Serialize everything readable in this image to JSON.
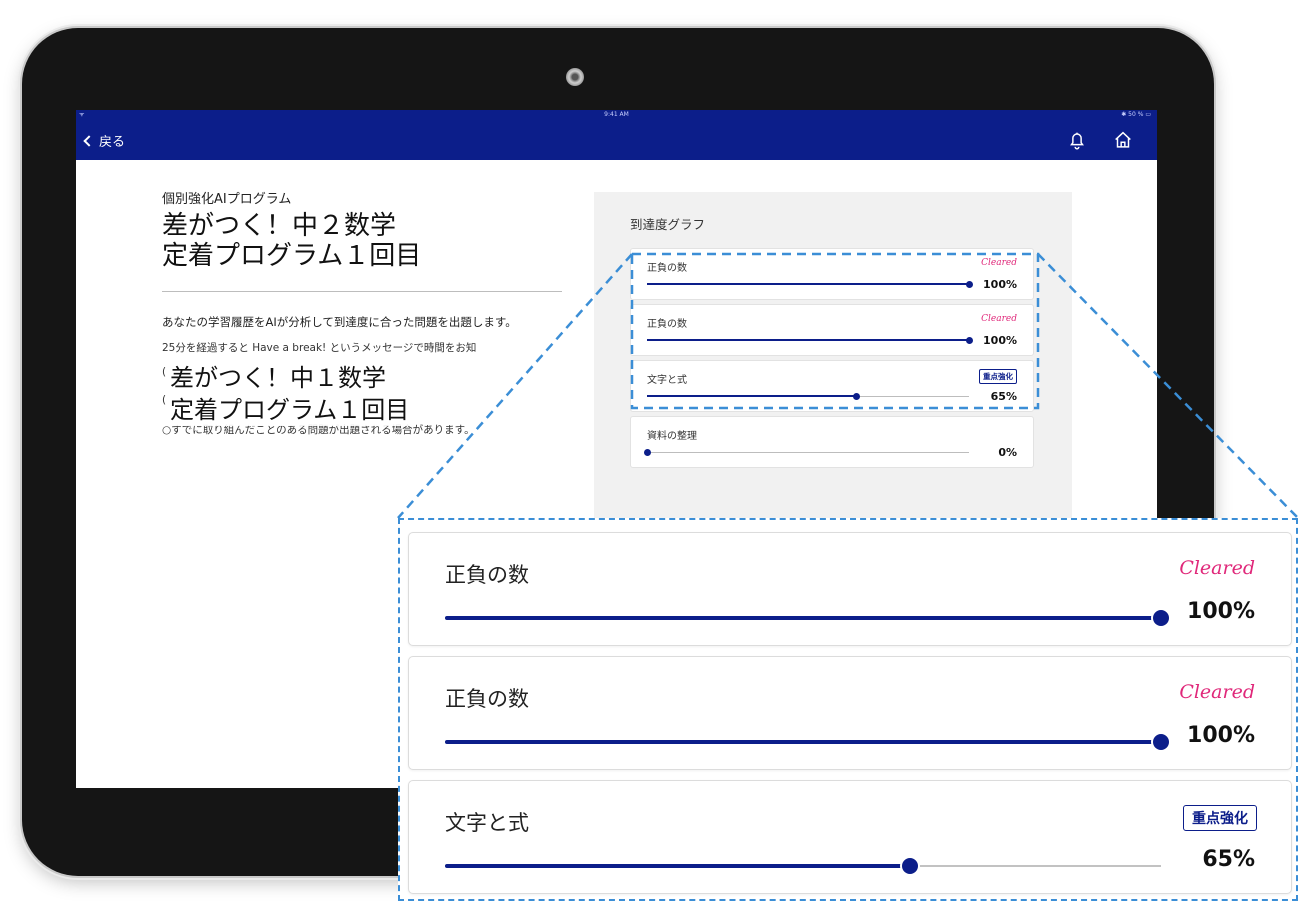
{
  "statusbar": {
    "wifi": "ᯤ",
    "time": "9:41 AM",
    "battery": "✱ 50 % ▭"
  },
  "nav": {
    "back_label": "戻る"
  },
  "left": {
    "subtitle": "個別強化AIプログラム",
    "title_line1": "差がつく！中２数学",
    "title_line2": "定着プログラム１回目",
    "description": "あなたの学習履歴をAIが分析して到達度に合った問題を出題します。",
    "note1": "25分を経過すると Have a break! というメッセージで時間をお知",
    "note_prefix1": "(",
    "note_prefix2": "(",
    "note3": "○すでに取り組んだことのある問題が出題される場合があります。",
    "overlay_line1": "差がつく！中１数学",
    "overlay_line2": "定着プログラム１回目"
  },
  "graph": {
    "title": "到達度グラフ",
    "items": [
      {
        "label": "正負の数",
        "badge": "Cleared",
        "badge_type": "cleared",
        "percent_text": "100%",
        "progress": 100
      },
      {
        "label": "正負の数",
        "badge": "Cleared",
        "badge_type": "cleared",
        "percent_text": "100%",
        "progress": 100
      },
      {
        "label": "文字と式",
        "badge": "重点強化",
        "badge_type": "focus",
        "percent_text": "65%",
        "progress": 65
      },
      {
        "label": "資料の整理",
        "badge": "",
        "badge_type": "none",
        "percent_text": "0%",
        "progress": 0
      }
    ]
  },
  "zoom": {
    "items": [
      {
        "label": "正負の数",
        "badge": "Cleared",
        "badge_type": "cleared",
        "percent_text": "100%",
        "progress": 100
      },
      {
        "label": "正負の数",
        "badge": "Cleared",
        "badge_type": "cleared",
        "percent_text": "100%",
        "progress": 100
      },
      {
        "label": "文字と式",
        "badge": "重点強化",
        "badge_type": "focus",
        "percent_text": "65%",
        "progress": 65
      }
    ]
  },
  "colors": {
    "nav": "#0c1e8a",
    "cleared": "#e0287a",
    "accent": "#0c1e8a",
    "callout": "#3b8ed6"
  }
}
